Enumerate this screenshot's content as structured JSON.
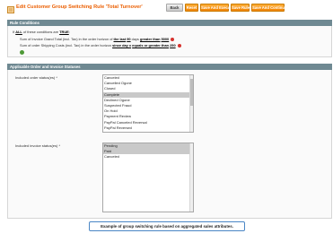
{
  "header": {
    "title": "Edit Customer Group Switching Rule 'Total Turnover'",
    "buttons": {
      "back": "Back",
      "reset": "Reset",
      "save_execute": "Save And Execute",
      "save_rule": "Save Rule",
      "save_continue": "Save And Continue Edit"
    }
  },
  "conditions": {
    "heading": "Rule Conditions",
    "intro_prefix": "If ",
    "intro_all": "ALL",
    "intro_middle": " of these conditions are ",
    "intro_true": "TRUE",
    "intro_suffix": ":",
    "line1": {
      "text": "Sum of Invoice Grand Total (incl. Tax) in the order horizon of ",
      "period": "the last",
      "num": "90",
      "unit": " days ",
      "op": "greater than",
      "value": "5000"
    },
    "line2": {
      "text": "Sum of order Shipping Costs (incl. Tax) in the order horizon ",
      "period": "since day x",
      "op": "equals or greater than",
      "value": "250"
    }
  },
  "statuses": {
    "heading": "Applicable Order and Invoice Statuses",
    "order_label": "Included order status(es) *",
    "order_items": [
      "Canceled",
      "Cancelled Ogone",
      "Closed",
      "Complete",
      "Declined Ogone",
      "Suspected Fraud",
      "On Hold",
      "Payment Review",
      "PayPal Canceled Reversal",
      "PayPal Reversed"
    ],
    "order_selected_index": 3,
    "invoice_label": "Included invoice status(es) *",
    "invoice_items": [
      "Pending",
      "Paid",
      "Canceled"
    ],
    "invoice_selected_indices": [
      0,
      1
    ]
  },
  "caption": "Example of group switching rule based on aggregated sales attributes.",
  "colors": {
    "title": "#eb5e00",
    "button": "#f18200",
    "section_header": "#6f8992",
    "caption_border": "#4a86c5"
  }
}
